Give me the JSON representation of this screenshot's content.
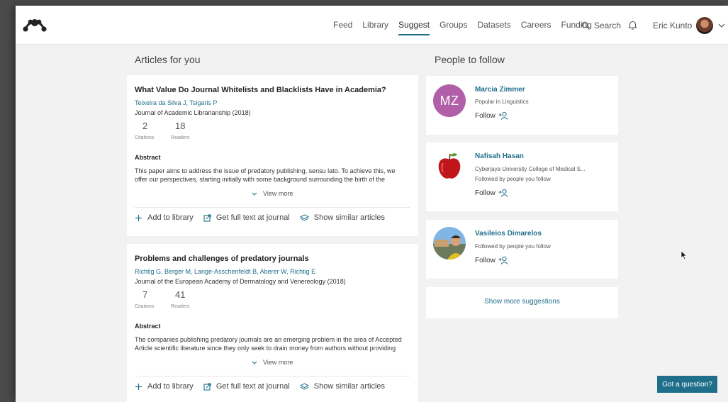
{
  "nav": {
    "items": [
      {
        "label": "Feed",
        "active": false
      },
      {
        "label": "Library",
        "active": false
      },
      {
        "label": "Suggest",
        "active": true
      },
      {
        "label": "Groups",
        "active": false
      },
      {
        "label": "Datasets",
        "active": false
      },
      {
        "label": "Careers",
        "active": false
      },
      {
        "label": "Funding",
        "active": false
      }
    ],
    "search_label": "Search",
    "user_name": "Eric Kunto"
  },
  "articles_section": {
    "title": "Articles for you",
    "articles": [
      {
        "title": "What Value Do Journal Whitelists and Blacklists Have in Academia?",
        "authors": "Teixeira da Silva J, Tsigaris P",
        "journal": "Journal of Academic Librarianship (2018)",
        "citations": "2",
        "citations_label": "Citations",
        "readers": "18",
        "readers_label": "Readers",
        "abstract_heading": "Abstract",
        "abstract": "This paper aims to address the issue of predatory publishing, sensu lato. To achieve this, we offer our perspectives, starting initially with some background surrounding the birth of the",
        "view_more": "View more",
        "add_to_library": "Add to library",
        "full_text": "Get full text at journal",
        "similar": "Show similar articles"
      },
      {
        "title": "Problems and challenges of predatory journals",
        "authors": "Richtig G, Berger M, Lange-Asschenfeldt B, Aberer W, Richtig E",
        "journal": "Journal of the European Academy of Dermatology and Venereology (2018)",
        "citations": "7",
        "citations_label": "Citations",
        "readers": "41",
        "readers_label": "Readers",
        "abstract_heading": "Abstract",
        "abstract": "The companies publishing predatory journals are an emerging problem in the area of Accepted Article scientific literature since they only seek to drain money from authors without providing",
        "view_more": "View more",
        "add_to_library": "Add to library",
        "full_text": "Get full text at journal",
        "similar": "Show similar articles"
      }
    ]
  },
  "people_section": {
    "title": "People to follow",
    "people": [
      {
        "name": "Marcia Zimmer",
        "initials": "MZ",
        "lines": [
          "Popular in Linguistics"
        ],
        "follow": "Follow",
        "avatar_color": "#b15fa8"
      },
      {
        "name": "Nafisah Hasan",
        "lines": [
          "Cyberjaya University College of Medical S...",
          "Followed by people you follow"
        ],
        "follow": "Follow"
      },
      {
        "name": "Vasileios Dimarelos",
        "lines": [
          "Followed by people you follow"
        ],
        "follow": "Follow"
      }
    ],
    "show_more": "Show more suggestions"
  },
  "help_button": "Got a question?",
  "colors": {
    "accent": "#1f6f8b",
    "background": "#f2f2f2"
  }
}
